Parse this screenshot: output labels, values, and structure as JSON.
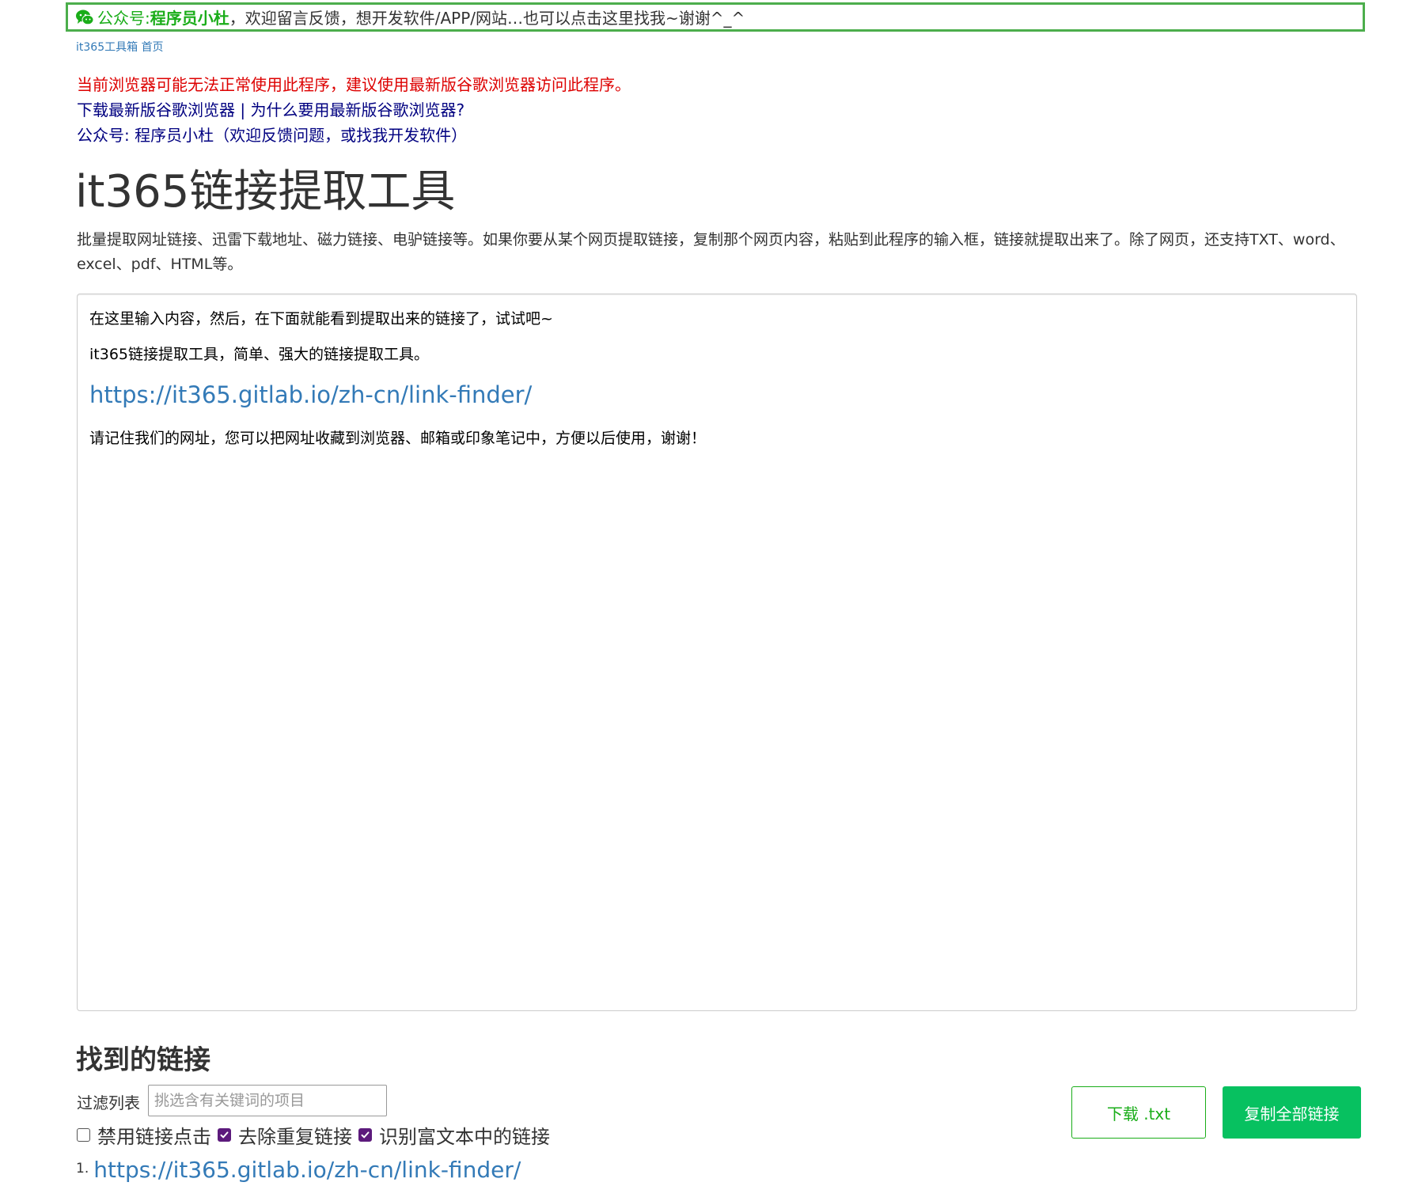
{
  "banner": {
    "label": "公众号: ",
    "name": "程序员小杜",
    "message": "，欢迎留言反馈，想开发软件/APP/网站…也可以点击这里找我~谢谢^_^",
    "icon": "wechat-icon",
    "border_color": "#4cae4c"
  },
  "breadcrumb": {
    "home_label": "it365工具箱",
    "current_label": "首页"
  },
  "notices": {
    "warning": "当前浏览器可能无法正常使用此程序，建议使用最新版谷歌浏览器访问此程序。",
    "download_chrome": "下载最新版谷歌浏览器",
    "separator": " | ",
    "why_chrome": "为什么要用最新版谷歌浏览器?",
    "wechat": "公众号: 程序员小杜（欢迎反馈问题，或找我开发软件）"
  },
  "page": {
    "title": "it365链接提取工具",
    "description": "批量提取网址链接、迅雷下载地址、磁力链接、电驴链接等。如果你要从某个网页提取链接，复制那个网页内容，粘贴到此程序的输入框，链接就提取出来了。除了网页，还支持TXT、word、excel、pdf、HTML等。"
  },
  "editor": {
    "line1": "在这里输入内容，然后，在下面就能看到提取出来的链接了，试试吧~",
    "line2": "it365链接提取工具，简单、强大的链接提取工具。",
    "link": "https://it365.gitlab.io/zh-cn/link-finder/",
    "line4": "请记住我们的网址，您可以把网址收藏到浏览器、邮箱或印象笔记中，方便以后使用，谢谢！"
  },
  "results": {
    "title": "找到的链接",
    "filter_label": "过滤列表",
    "filter_placeholder": "挑选含有关键词的项目",
    "filter_value": "",
    "options": [
      {
        "label": "禁用链接点击",
        "checked": false
      },
      {
        "label": "去除重复链接",
        "checked": true
      },
      {
        "label": "识别富文本中的链接",
        "checked": true
      }
    ],
    "download_label": "下载 .txt",
    "copy_label": "复制全部链接",
    "items": [
      {
        "index": "1.",
        "url": "https://it365.gitlab.io/zh-cn/link-finder/"
      }
    ]
  },
  "colors": {
    "brand_green": "#1aad19",
    "button_green": "#07c160",
    "link_blue": "#337ab7",
    "warning_red": "#dd0000",
    "notice_navy": "#000080",
    "checkbox_purple": "#5c1a7c"
  }
}
